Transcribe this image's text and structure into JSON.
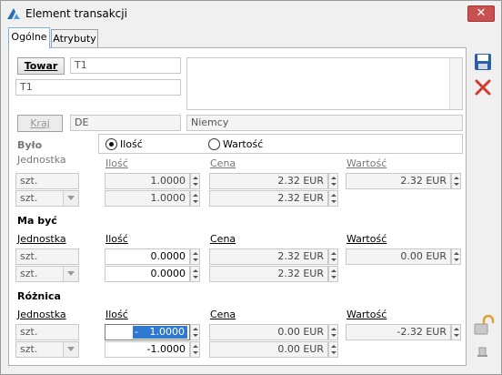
{
  "window": {
    "title": "Element transakcji",
    "close": "✕"
  },
  "tabs": [
    {
      "label": "Ogólne"
    },
    {
      "label": "Atrybuty"
    }
  ],
  "towar": {
    "button": "Towar",
    "code": "T1",
    "name": "T1"
  },
  "kraj": {
    "button": "Kraj",
    "code": "DE",
    "name": "Niemcy"
  },
  "bylo": {
    "section": "Było",
    "radio_ilosc": "Ilość",
    "radio_wartosc": "Wartość",
    "col_jednostka": "Jednostka",
    "col_ilosc": "Ilość",
    "col_cena": "Cena",
    "col_wartosc": "Wartość",
    "row1": {
      "unit": "szt.",
      "qty": "1.0000",
      "price": "2.32 EUR",
      "value": "2.32 EUR"
    },
    "row2": {
      "unit": "szt.",
      "qty": "1.0000",
      "price": "2.32 EUR"
    }
  },
  "ma_byc": {
    "section": "Ma być",
    "col_jednostka": "Jednostka",
    "col_ilosc": "Ilość",
    "col_cena": "Cena",
    "col_wartosc": "Wartość",
    "row1": {
      "unit": "szt.",
      "qty": "0.0000",
      "price": "2.32 EUR",
      "value": "0.00 EUR"
    },
    "row2": {
      "unit": "szt.",
      "qty": "0.0000",
      "price": "2.32 EUR"
    }
  },
  "roznica": {
    "section": "Różnica",
    "col_jednostka": "Jednostka",
    "col_ilosc": "Ilość",
    "col_cena": "Cena",
    "col_wartosc": "Wartość",
    "row1": {
      "unit": "szt.",
      "qty_sign": "-",
      "qty": "1.0000",
      "price": "0.00 EUR",
      "value": "-2.32 EUR"
    },
    "row2": {
      "unit": "szt.",
      "qty": "-1.0000",
      "price": "0.00 EUR"
    }
  },
  "colors": {
    "save": "#2d5fa8",
    "cancel": "#d03a2a",
    "selection": "#3078d0"
  }
}
